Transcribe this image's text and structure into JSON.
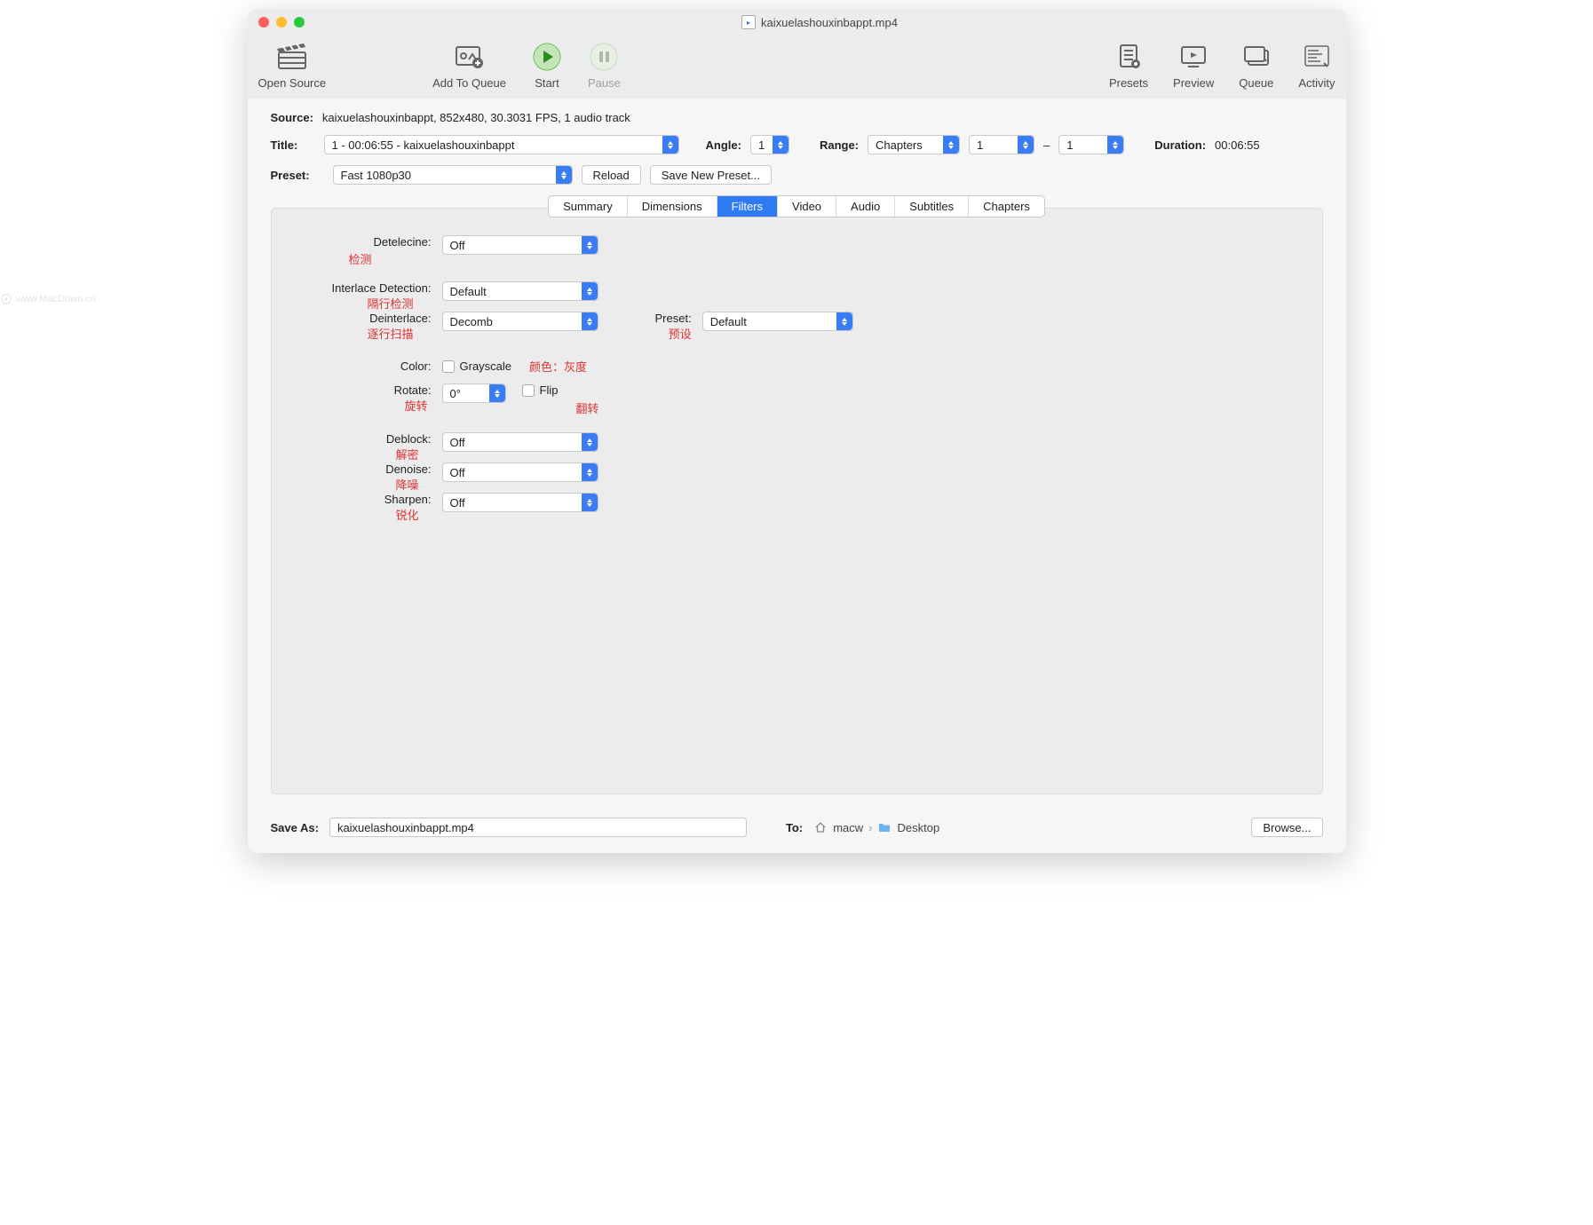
{
  "title_filename": "kaixuelashouxinbappt.mp4",
  "toolbar": {
    "open_source": "Open Source",
    "add_queue": "Add To Queue",
    "start": "Start",
    "pause": "Pause",
    "presets": "Presets",
    "preview": "Preview",
    "queue": "Queue",
    "activity": "Activity"
  },
  "source": {
    "label": "Source:",
    "value": "kaixuelashouxinbappt, 852x480, 30.3031 FPS, 1 audio track"
  },
  "title": {
    "label": "Title:",
    "value": "1 - 00:06:55 - kaixuelashouxinbappt"
  },
  "angle": {
    "label": "Angle:",
    "value": "1"
  },
  "range": {
    "label": "Range:",
    "mode": "Chapters",
    "from": "1",
    "dash": "–",
    "to": "1"
  },
  "duration": {
    "label": "Duration:",
    "value": "00:06:55"
  },
  "preset": {
    "label": "Preset:",
    "value": "Fast 1080p30",
    "reload": "Reload",
    "save_new": "Save New Preset..."
  },
  "tabs": [
    "Summary",
    "Dimensions",
    "Filters",
    "Video",
    "Audio",
    "Subtitles",
    "Chapters"
  ],
  "filters": {
    "detelecine": {
      "label": "Detelecine:",
      "value": "Off",
      "annot": "检测"
    },
    "interlace_det": {
      "label": "Interlace Detection:",
      "value": "Default",
      "annot": "隔行检测"
    },
    "deinterlace": {
      "label": "Deinterlace:",
      "value": "Decomb",
      "annot": "逐行扫描"
    },
    "deint_preset": {
      "label": "Preset:",
      "value": "Default",
      "annot": "预设"
    },
    "color": {
      "label": "Color:",
      "cb_label": "Grayscale",
      "annot": "颜色：灰度"
    },
    "rotate": {
      "label": "Rotate:",
      "value": "0°",
      "flip_label": "Flip",
      "annot": "旋转",
      "flip_annot": "翻转"
    },
    "deblock": {
      "label": "Deblock:",
      "value": "Off",
      "annot": "解密"
    },
    "denoise": {
      "label": "Denoise:",
      "value": "Off",
      "annot": "降噪"
    },
    "sharpen": {
      "label": "Sharpen:",
      "value": "Off",
      "annot": "锐化"
    }
  },
  "save": {
    "label": "Save As:",
    "filename": "kaixuelashouxinbappt.mp4",
    "to_label": "To:",
    "path_user": "macw",
    "path_sep": "›",
    "path_folder": "Desktop",
    "browse": "Browse..."
  },
  "watermark": "www.MacDown.co"
}
